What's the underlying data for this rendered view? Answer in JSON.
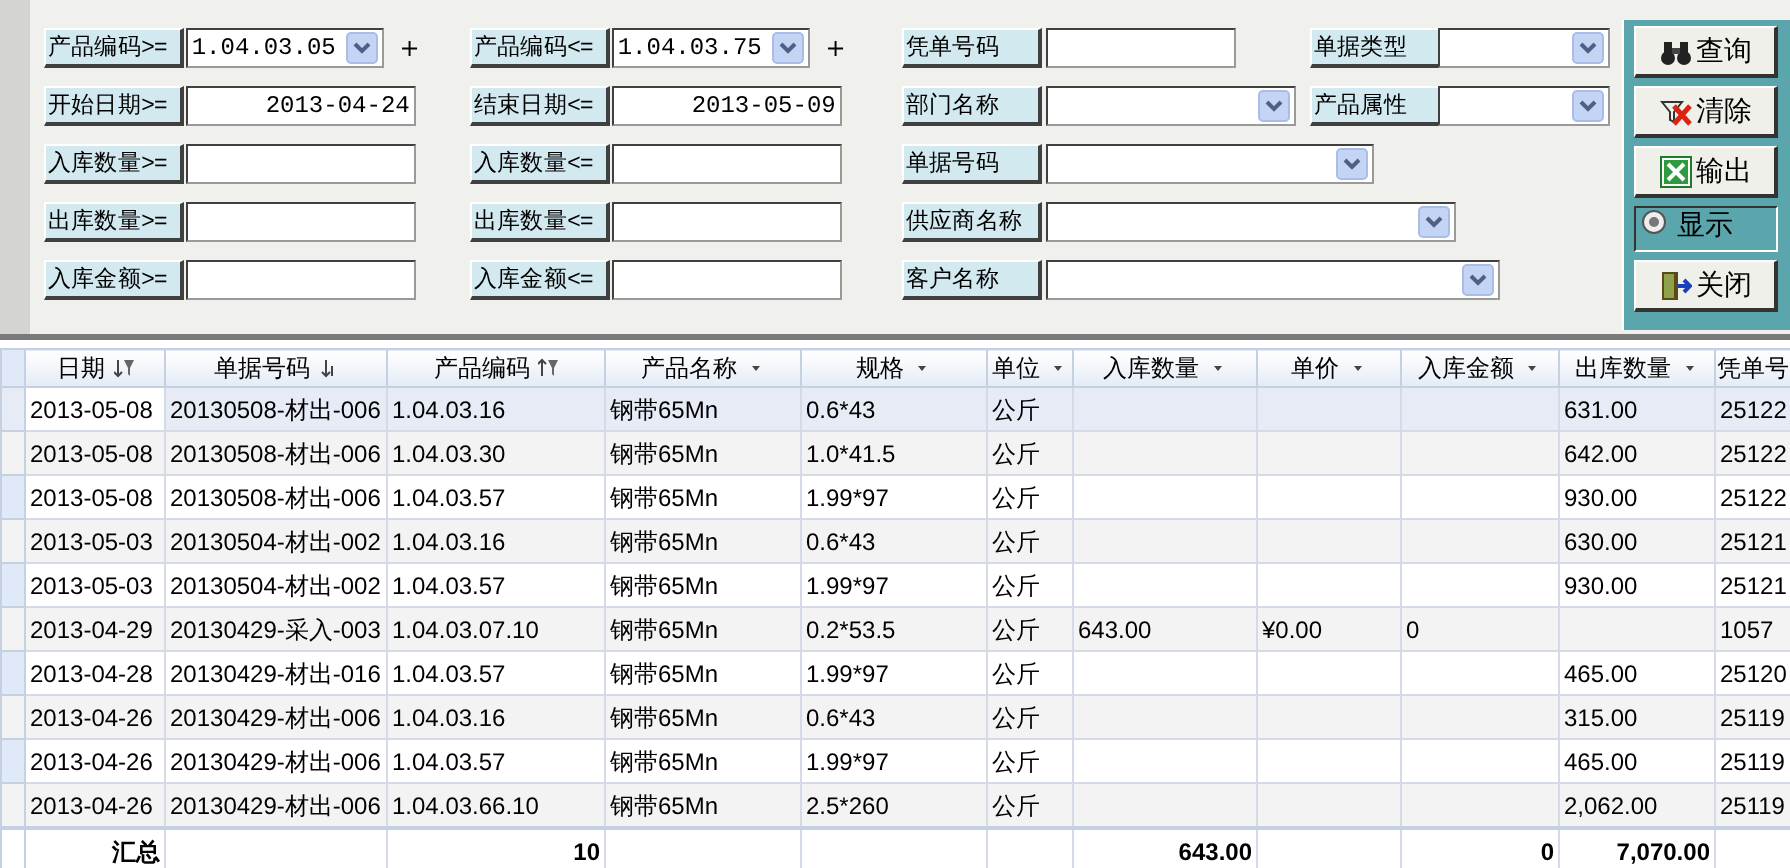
{
  "filters": [
    {
      "label": "产品编码>=",
      "kind": "combo",
      "value": "1.04.03.05",
      "suffix": "+"
    },
    {
      "label": "产品编码<=",
      "kind": "combo",
      "value": "1.04.03.75",
      "suffix": "+"
    },
    {
      "label": "凭单号码",
      "kind": "text"
    },
    {
      "label": "单据类型",
      "kind": "combo"
    },
    {
      "label": "开始日期>=",
      "kind": "date",
      "value": "2013-04-24"
    },
    {
      "label": "结束日期<=",
      "kind": "date",
      "value": "2013-05-09"
    },
    {
      "label": "部门名称",
      "kind": "combo"
    },
    {
      "label": "产品属性",
      "kind": "combo"
    },
    {
      "label": "入库数量>=",
      "kind": "text"
    },
    {
      "label": "入库数量<=",
      "kind": "text"
    },
    {
      "label": "单据号码",
      "kind": "combo"
    },
    {
      "label": "出库数量>=",
      "kind": "text"
    },
    {
      "label": "出库数量<=",
      "kind": "text"
    },
    {
      "label": "供应商名称",
      "kind": "combo"
    },
    {
      "label": "入库金额>=",
      "kind": "text"
    },
    {
      "label": "入库金额<=",
      "kind": "text"
    },
    {
      "label": "客户名称",
      "kind": "combo"
    }
  ],
  "buttons": [
    {
      "label": "查询",
      "kind": "search",
      "pressed": false
    },
    {
      "label": "清除",
      "kind": "clear",
      "pressed": false
    },
    {
      "label": "输出",
      "kind": "export",
      "pressed": false
    },
    {
      "label": "显示",
      "kind": "toggle",
      "pressed": true
    },
    {
      "label": "关闭",
      "kind": "close",
      "pressed": false
    }
  ],
  "table": {
    "columns": [
      {
        "label": "日期",
        "kind": "sort-filter"
      },
      {
        "label": "单据号码",
        "kind": "sort"
      },
      {
        "label": "产品编码",
        "kind": "filter"
      },
      {
        "label": "产品名称",
        "kind": "menu"
      },
      {
        "label": "规格",
        "kind": "menu"
      },
      {
        "label": "单位",
        "kind": "menu"
      },
      {
        "label": "入库数量",
        "kind": "menu"
      },
      {
        "label": "单价",
        "kind": "menu"
      },
      {
        "label": "入库金额",
        "kind": "menu"
      },
      {
        "label": "出库数量",
        "kind": "menu"
      },
      {
        "label": "凭单号",
        "kind": "plain"
      }
    ],
    "rows": [
      {
        "selected": true,
        "cells": [
          "2013-05-08",
          "20130508-材出-006",
          "1.04.03.16",
          "钢带65Mn",
          "0.6*43",
          "公斤",
          null,
          null,
          null,
          "631.00",
          "25122"
        ]
      },
      {
        "selected": false,
        "cells": [
          "2013-05-08",
          "20130508-材出-006",
          "1.04.03.30",
          "钢带65Mn",
          "1.0*41.5",
          "公斤",
          null,
          null,
          null,
          "642.00",
          "25122"
        ]
      },
      {
        "selected": false,
        "cells": [
          "2013-05-08",
          "20130508-材出-006",
          "1.04.03.57",
          "钢带65Mn",
          "1.99*97",
          "公斤",
          null,
          null,
          null,
          "930.00",
          "25122"
        ]
      },
      {
        "selected": false,
        "cells": [
          "2013-05-03",
          "20130504-材出-002",
          "1.04.03.16",
          "钢带65Mn",
          "0.6*43",
          "公斤",
          null,
          null,
          null,
          "630.00",
          "25121"
        ]
      },
      {
        "selected": false,
        "cells": [
          "2013-05-03",
          "20130504-材出-002",
          "1.04.03.57",
          "钢带65Mn",
          "1.99*97",
          "公斤",
          null,
          null,
          null,
          "930.00",
          "25121"
        ]
      },
      {
        "selected": false,
        "cells": [
          "2013-04-29",
          "20130429-采入-003",
          "1.04.03.07.10",
          "钢带65Mn",
          "0.2*53.5",
          "公斤",
          "643.00",
          "¥0.00",
          "0",
          null,
          "1057"
        ]
      },
      {
        "selected": false,
        "cells": [
          "2013-04-28",
          "20130429-材出-016",
          "1.04.03.57",
          "钢带65Mn",
          "1.99*97",
          "公斤",
          null,
          null,
          null,
          "465.00",
          "25120"
        ]
      },
      {
        "selected": false,
        "cells": [
          "2013-04-26",
          "20130429-材出-006",
          "1.04.03.16",
          "钢带65Mn",
          "0.6*43",
          "公斤",
          null,
          null,
          null,
          "315.00",
          "25119"
        ]
      },
      {
        "selected": false,
        "cells": [
          "2013-04-26",
          "20130429-材出-006",
          "1.04.03.57",
          "钢带65Mn",
          "1.99*97",
          "公斤",
          null,
          null,
          null,
          "465.00",
          "25119"
        ]
      },
      {
        "selected": false,
        "cells": [
          "2013-04-26",
          "20130429-材出-006",
          "1.04.03.66.10",
          "钢带65Mn",
          "2.5*260",
          "公斤",
          null,
          null,
          null,
          "2,062.00",
          "25119"
        ]
      }
    ],
    "totals": {
      "label": "汇总",
      "count": "10",
      "in_quantity": "643.00",
      "in_amount": "0",
      "out_quantity": "7,070.00"
    }
  }
}
